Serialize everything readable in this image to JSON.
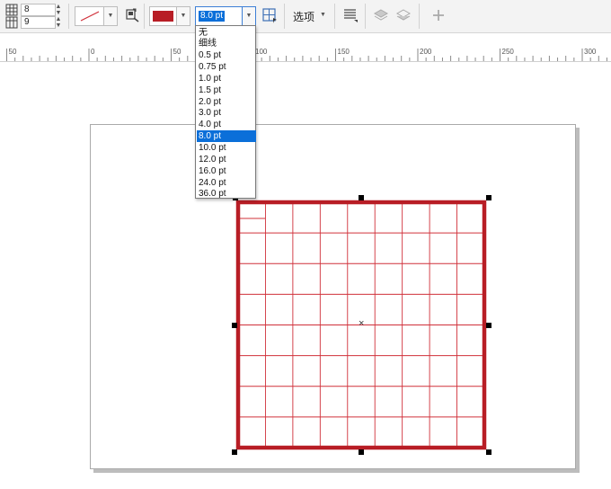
{
  "toolbar": {
    "rows_value": "8",
    "cols_value": "9",
    "outline_color": "#b81d25",
    "line_width_value": "8.0 pt",
    "options_label": "选项",
    "icons": [
      "table-rows-icon",
      "table-columns-icon",
      "line-style-icon",
      "eyedropper-icon",
      "border-select-icon",
      "wrap-text-icon",
      "arrange-front-icon",
      "arrange-back-icon",
      "plus-icon"
    ]
  },
  "width_dropdown": {
    "options": [
      "无",
      "细线",
      "0.5 pt",
      "0.75 pt",
      "1.0 pt",
      "1.5 pt",
      "2.0 pt",
      "3.0 pt",
      "4.0 pt",
      "8.0 pt",
      "10.0 pt",
      "12.0 pt",
      "16.0 pt",
      "24.0 pt",
      "36.0 pt"
    ],
    "selected": "8.0 pt"
  },
  "ruler": {
    "labels": [
      "50",
      "0",
      "50",
      "100",
      "150",
      "200",
      "250",
      "300"
    ]
  },
  "table": {
    "rows": 8,
    "columns": 9,
    "line_color": "#d0303a",
    "border_color": "#b81d25"
  }
}
